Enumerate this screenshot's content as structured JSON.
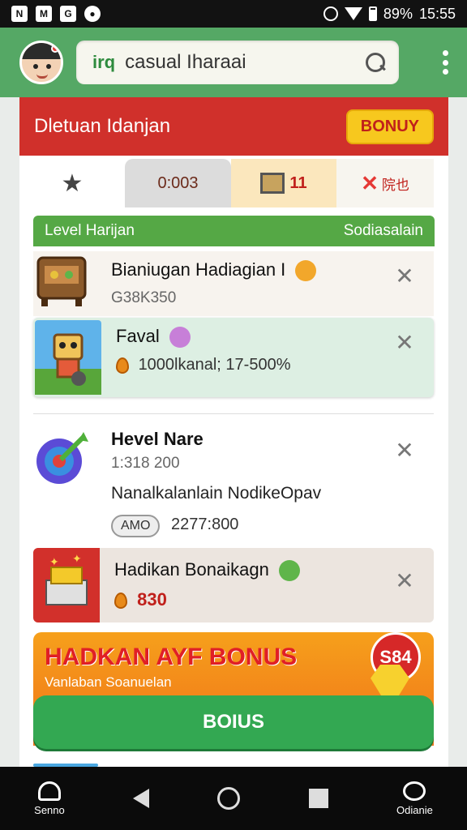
{
  "status_bar": {
    "left_icons": [
      "N",
      "M",
      "G",
      "●"
    ],
    "battery": "89%",
    "time": "15:55"
  },
  "header": {
    "search_prefix": "irq",
    "search_value": "casual Iharaai"
  },
  "banner": {
    "title": "Dletuan Idanjan",
    "badge": "BONUY"
  },
  "tabs": [
    {
      "label": "★"
    },
    {
      "label": "0:003"
    },
    {
      "label": "11"
    },
    {
      "label": "院也"
    }
  ],
  "level_section": {
    "left": "Level Harijan",
    "right": "Sodiasalain"
  },
  "items": [
    {
      "title": "Bianiugan Hadiagian I",
      "sub": "G38K350"
    },
    {
      "title": "Faval",
      "sub": "1000lkanal; 17-500%"
    },
    {
      "title": "Hevel Nare",
      "sub": "1:318 200",
      "desc": "Nanalkalanlain NodikeOpav",
      "pill": "AMO",
      "pill_value": "2277:800"
    },
    {
      "title": "Hadikan Bonaikagn",
      "sub": "830"
    }
  ],
  "promo": {
    "title": "HADKAN AYF BONUS",
    "subtitle": "Vanlaban Soanuelan",
    "tag": "S84",
    "button": "BOIUS"
  },
  "nav": {
    "left_label": "Senno",
    "right_label": "Odianie"
  },
  "colors": {
    "header_green": "#55a865",
    "banner_red": "#d0302b",
    "badge_yellow": "#f7c81e",
    "button_green": "#33a852"
  }
}
